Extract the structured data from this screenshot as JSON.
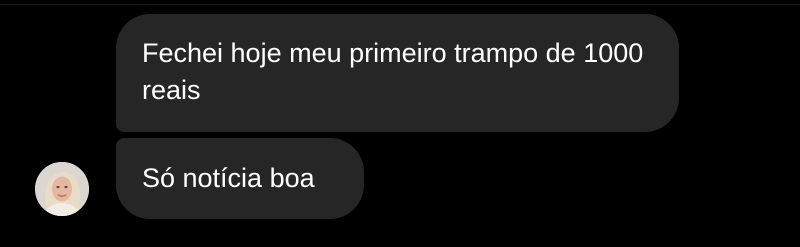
{
  "conversation": {
    "messages": [
      {
        "text": "Fechei hoje meu primeiro trampo de 1000 reais"
      },
      {
        "text": "Só notícia boa"
      }
    ],
    "sender": {
      "avatar_icon": "user-avatar-icon"
    }
  },
  "colors": {
    "background": "#000000",
    "bubble_incoming": "#262626",
    "text": "#ffffff"
  }
}
